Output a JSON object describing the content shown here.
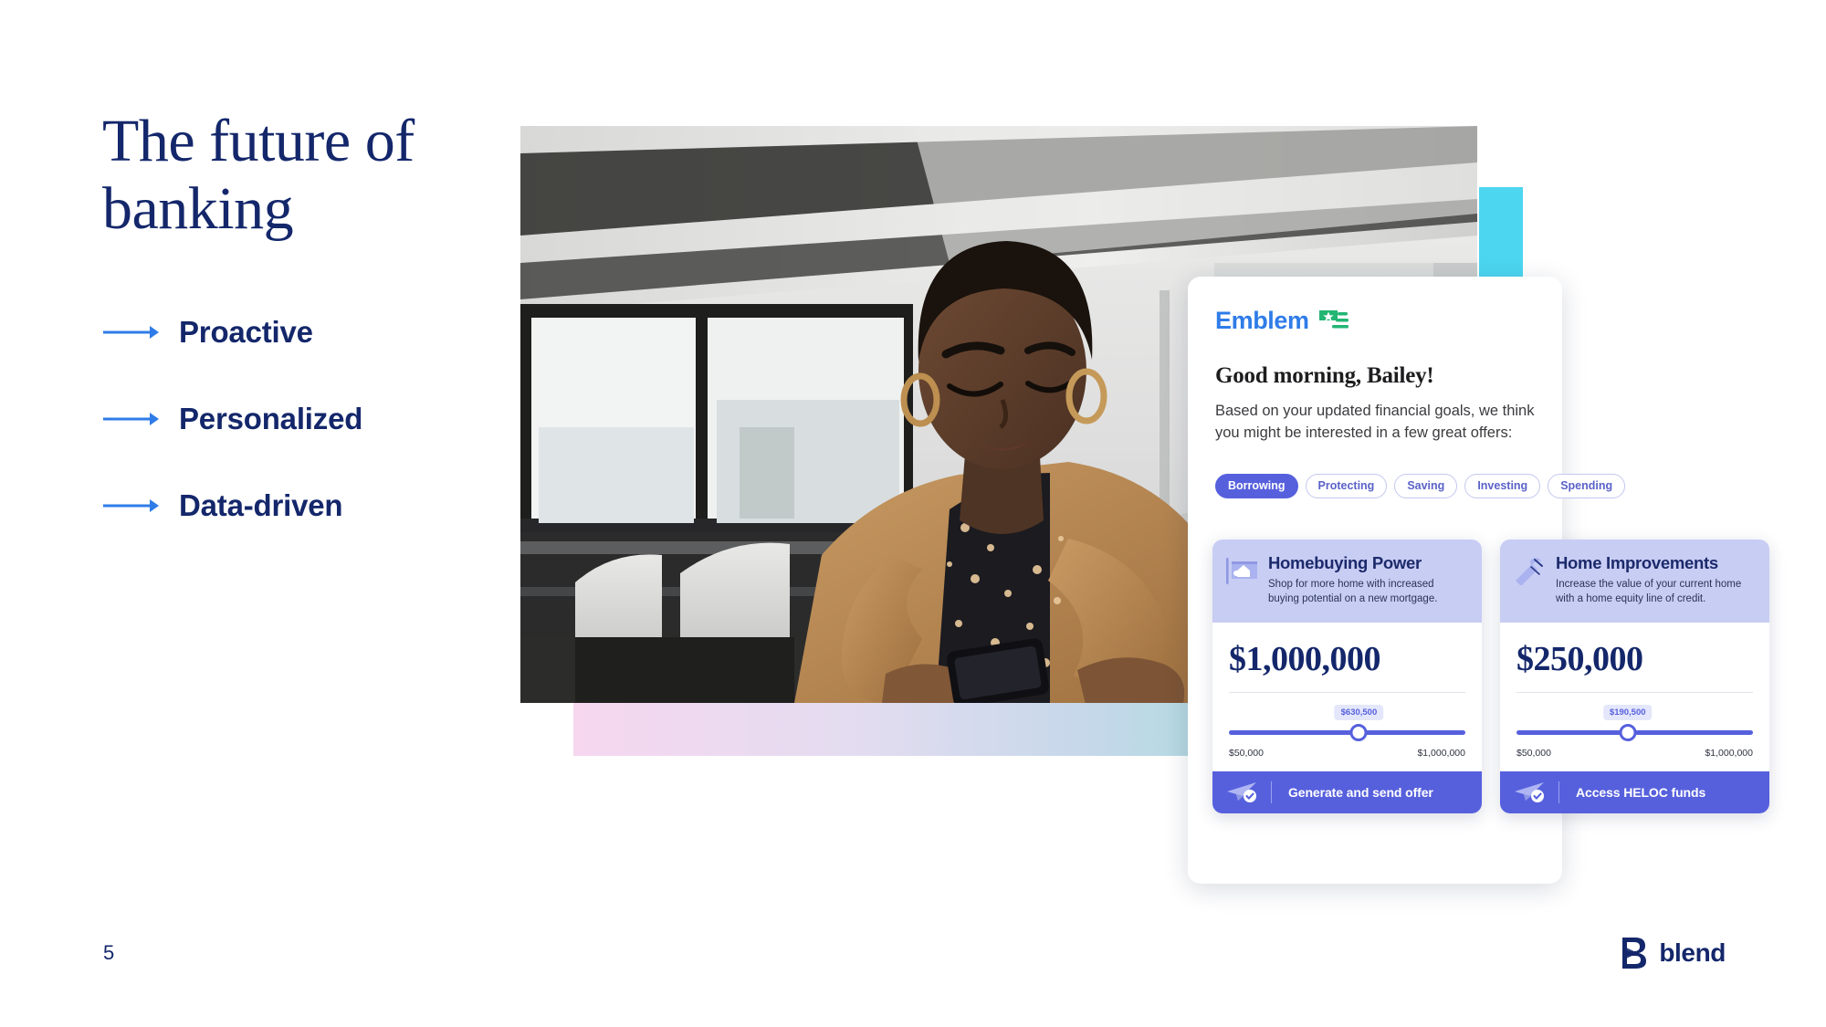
{
  "slide": {
    "title": "The future of banking",
    "page_number": "5",
    "bullets": [
      {
        "label": "Proactive",
        "icon": "arrow-right-icon"
      },
      {
        "label": "Personalized",
        "icon": "arrow-right-icon"
      },
      {
        "label": "Data-driven",
        "icon": "arrow-right-icon"
      }
    ]
  },
  "colors": {
    "navy": "#14276b",
    "arrow_blue": "#2f7ce8",
    "cyan_block": "#4cd6f0",
    "indigo": "#5660dd",
    "lavender": "#c8cdf4",
    "emblem_blue": "#2f7ce8",
    "emblem_green": "#22b573"
  },
  "app": {
    "brand": "Emblem",
    "brand_icon": "flag-star-icon",
    "greeting": "Good morning, Bailey!",
    "subcopy": "Based on your updated financial goals, we think you might be interested in a few great offers:",
    "tabs": [
      {
        "label": "Borrowing",
        "active": true
      },
      {
        "label": "Protecting",
        "active": false
      },
      {
        "label": "Saving",
        "active": false
      },
      {
        "label": "Investing",
        "active": false
      },
      {
        "label": "Spending",
        "active": false
      }
    ],
    "offers": [
      {
        "icon": "house-window-icon",
        "title": "Homebuying Power",
        "description": "Shop for more home with increased buying potential on a new mortgage.",
        "amount": "$1,000,000",
        "slider": {
          "tooltip": "$630,500",
          "min_label": "$50,000",
          "max_label": "$1,000,000",
          "percent": 62
        },
        "cta": {
          "label": "Generate and send offer",
          "icon": "paper-plane-check-icon"
        }
      },
      {
        "icon": "hammer-icon",
        "title": "Home Improvements",
        "description": "Increase the value of your current home with a home equity line of credit.",
        "amount": "$250,000",
        "slider": {
          "tooltip": "$190,500",
          "min_label": "$50,000",
          "max_label": "$1,000,000",
          "percent": 55
        },
        "cta": {
          "label": "Access HELOC funds",
          "icon": "paper-plane-check-icon"
        }
      }
    ]
  },
  "footer": {
    "logo_text": "blend",
    "logo_mark": "blend-b-icon"
  }
}
